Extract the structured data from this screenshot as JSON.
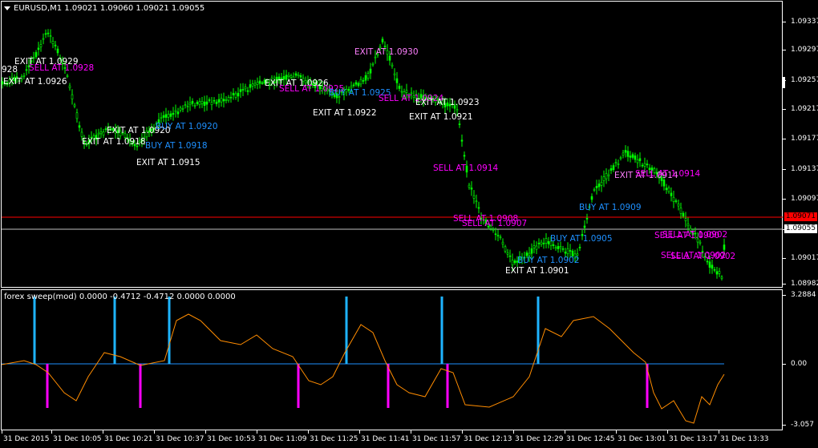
{
  "window": {
    "symbol_header": "EURUSD,M1  1.09021 1.09060 1.09021 1.09055",
    "indicator_header": "forex sweep(mod) 0.0000 -0.4712 -0.4712 0.0000 0.0000"
  },
  "price_axis": {
    "labels": [
      "1.09337",
      "1.09297",
      "1.09257",
      "1.09217",
      "1.09177",
      "1.09137",
      "1.09097",
      "1.09057",
      "1.09017",
      "1.08982"
    ],
    "current_price": "1.09055",
    "alert_price": "1.09071"
  },
  "indicator_axis": {
    "labels": [
      "3.2884",
      "0.00",
      "-3.057"
    ]
  },
  "time_axis": {
    "labels": [
      "31 Dec 2015",
      "31 Dec 10:05",
      "31 Dec 10:21",
      "31 Dec 10:37",
      "31 Dec 10:53",
      "31 Dec 11:09",
      "31 Dec 11:25",
      "31 Dec 11:41",
      "31 Dec 11:57",
      "31 Dec 12:13",
      "31 Dec 12:29",
      "31 Dec 12:45",
      "31 Dec 13:01",
      "31 Dec 13:17",
      "31 Dec 13:33"
    ]
  },
  "colors": {
    "background": "#000000",
    "candles": "#00ff00",
    "alert_line": "#ff0000",
    "bid_line": "#c0c0c0",
    "exit_text": "#ffffff",
    "buy_text": "#1e90ff",
    "sell_text": "#ff00ff",
    "osc_line": "#ff8c00",
    "zero_line": "#1e90ff",
    "buy_bar": "#1eb4ff",
    "sell_bar": "#ff00ff"
  },
  "signals": [
    {
      "text": "928",
      "kind": "exit"
    },
    {
      "text": "EXIT AT 1.0929",
      "kind": "exit"
    },
    {
      "text": "SELL AT 1.0928",
      "kind": "sell"
    },
    {
      "text": "EXIT AT 1.0926",
      "kind": "exit"
    },
    {
      "text": "EXIT AT 1.0920",
      "kind": "exit"
    },
    {
      "text": "BUY AT 1.0920",
      "kind": "buy"
    },
    {
      "text": "EXIT AT 1.0918",
      "kind": "exit"
    },
    {
      "text": "BUY AT 1.0918",
      "kind": "buy"
    },
    {
      "text": "EXIT AT 1.0915",
      "kind": "exit"
    },
    {
      "text": "EXIT AT 1.0926",
      "kind": "exit"
    },
    {
      "text": "SELL AT 1.0925",
      "kind": "sell"
    },
    {
      "text": "BUY AT 1.0925",
      "kind": "buy"
    },
    {
      "text": "EXIT AT 1.0922",
      "kind": "exit"
    },
    {
      "text": "EXIT AT 1.0930",
      "kind": "sell"
    },
    {
      "text": "SELL AT 1.0924",
      "kind": "sell"
    },
    {
      "text": "EXIT AT 1.0923",
      "kind": "exit"
    },
    {
      "text": "EXIT AT 1.0921",
      "kind": "exit"
    },
    {
      "text": "SELL AT 1.0914",
      "kind": "sell"
    },
    {
      "text": "SELL AT 1.0908",
      "kind": "sell"
    },
    {
      "text": "SELL AT 1.0907",
      "kind": "sell"
    },
    {
      "text": "BUY AT 1.0905",
      "kind": "buy"
    },
    {
      "text": "BUY AT 1.0902",
      "kind": "buy"
    },
    {
      "text": "EXIT AT 1.0901",
      "kind": "exit"
    },
    {
      "text": "BUY AT 1.0909",
      "kind": "buy"
    },
    {
      "text": "EXIT AT 1.0914",
      "kind": "exit"
    },
    {
      "text": "SELL AT 1.0914",
      "kind": "sell"
    },
    {
      "text": "SELL AT 1.0900",
      "kind": "sell"
    },
    {
      "text": "SELL AT 1.0902",
      "kind": "sell"
    },
    {
      "text": "SELL AT 1.0902",
      "kind": "sell"
    },
    {
      "text": "SELL AT 1.0902",
      "kind": "sell"
    }
  ]
}
